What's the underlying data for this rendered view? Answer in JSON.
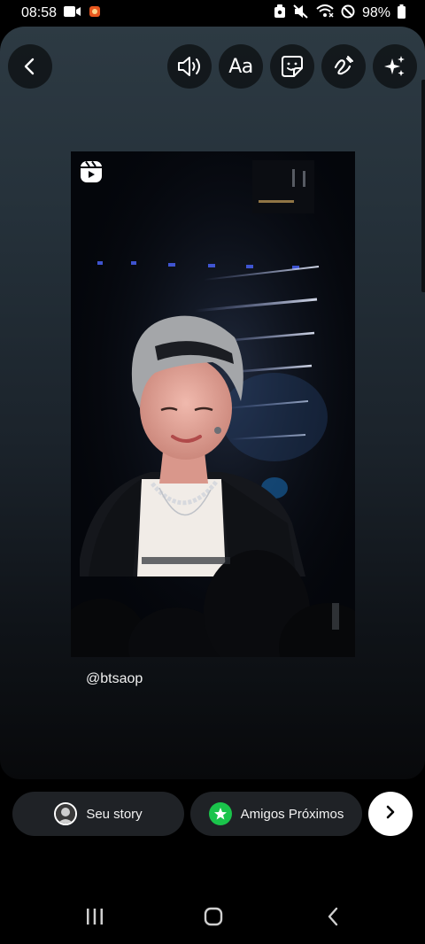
{
  "status_bar": {
    "time": "08:58",
    "battery": "98%",
    "icons": [
      "video-camera-icon",
      "notification-app-icon",
      "alarm-icon",
      "mute-icon",
      "wifi-icon",
      "do-not-disturb-icon",
      "battery-icon"
    ]
  },
  "toolbar": {
    "back_icon": "chevron-left-icon",
    "sound_icon": "speaker-icon",
    "text_label": "Aa",
    "sticker_icon": "sticker-icon",
    "draw_icon": "scribble-icon",
    "effects_icon": "sparkles-icon"
  },
  "post": {
    "type_icon": "reels-icon",
    "mention": "@btsaop"
  },
  "share": {
    "your_story_label": "Seu story",
    "close_friends_label": "Amigos Próximos",
    "next_icon": "chevron-right-icon"
  },
  "colors": {
    "close_friends_green": "#1ac44b",
    "pill_bg": "#1f2226"
  },
  "nav": {
    "icons": [
      "recent-apps-icon",
      "home-icon",
      "back-icon"
    ]
  }
}
